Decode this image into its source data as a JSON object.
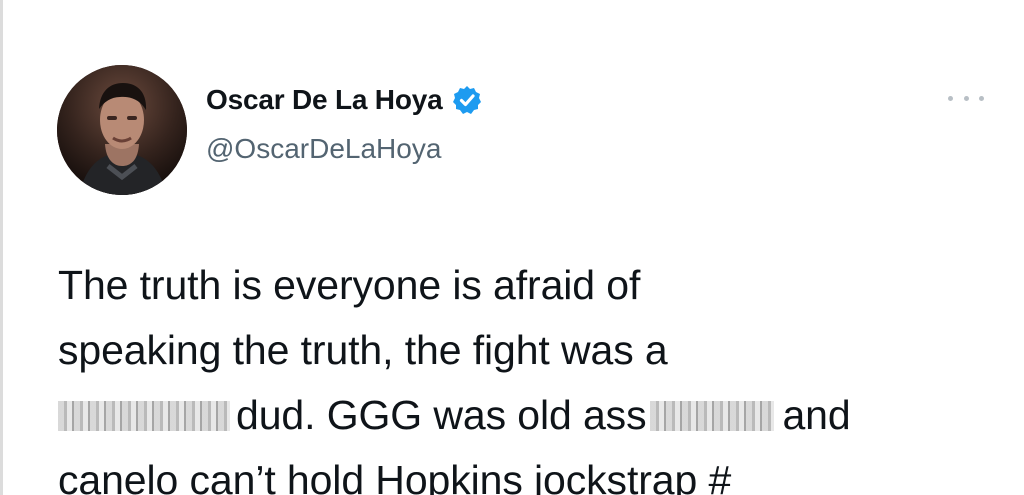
{
  "tweet": {
    "author": {
      "display_name": "Oscar De La Hoya",
      "handle": "@OscarDeLaHoya",
      "verified": true,
      "badge_color": "#1d9bf0"
    },
    "more_icon": "more-horizontal-icon",
    "text_lines": [
      {
        "text": "The truth is everyone is afraid of"
      },
      {
        "text": "speaking the truth, the fight was a"
      },
      {
        "before": "",
        "after_first": "dud. GGG was old ass",
        "after_second": "and"
      },
      {
        "text": "canelo can’t hold Hopkins jockstrap #"
      }
    ],
    "censored_words": [
      "censored-word",
      "censored-word"
    ]
  },
  "colors": {
    "text_primary": "#0f1419",
    "text_secondary": "#536471",
    "verified_blue": "#1d9bf0"
  }
}
